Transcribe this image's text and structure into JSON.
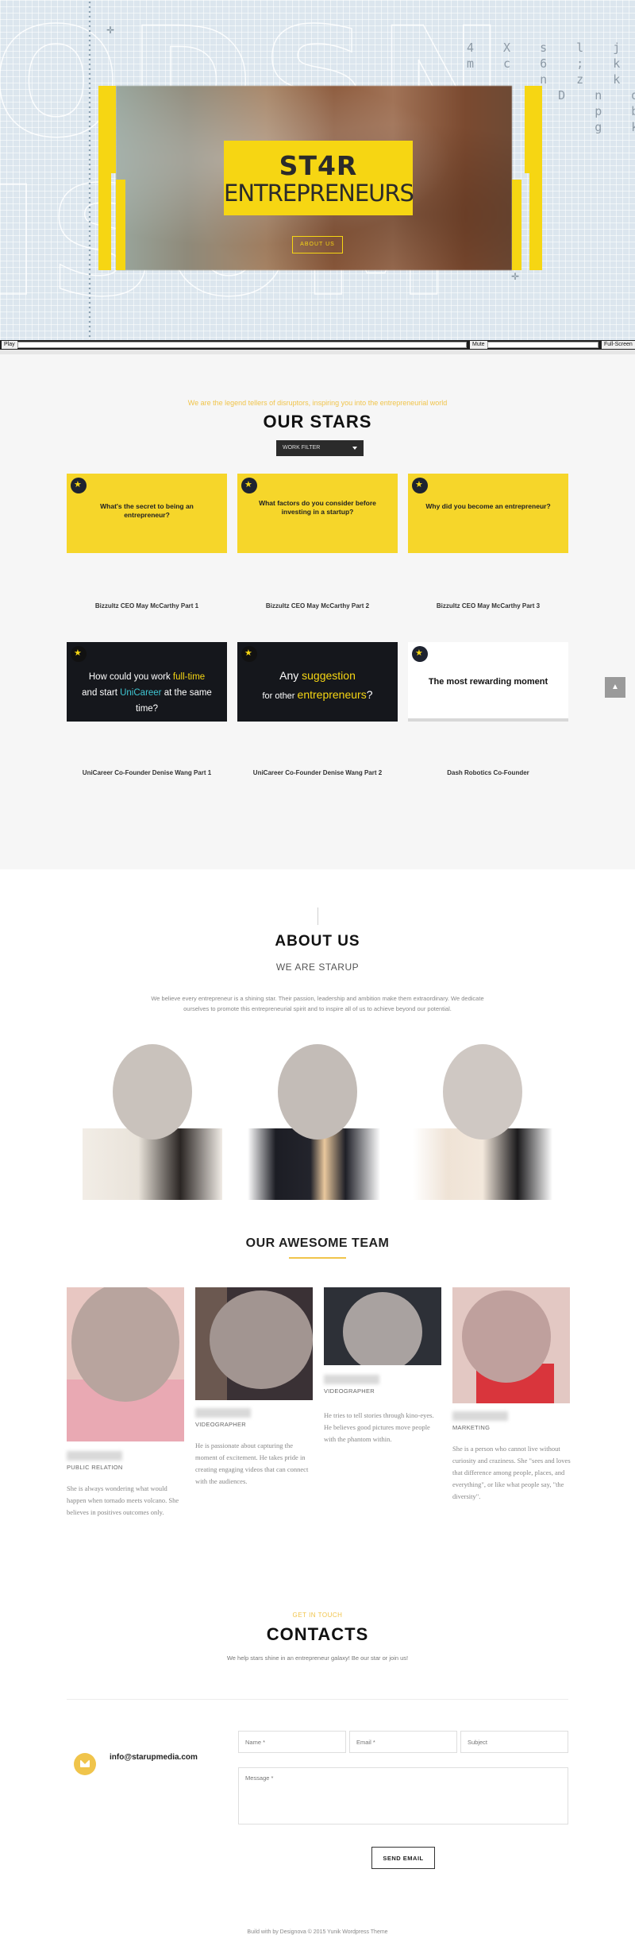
{
  "hero": {
    "logo_line1": "ST4R",
    "logo_line2": "ENTREPRENEURS",
    "about_button": "ABOUT US",
    "player": {
      "play_label": "Play",
      "mute_label": "Mute",
      "fullscreen_label": "Full-Screen"
    }
  },
  "stars": {
    "tagline": "We are the legend tellers of disruptors, inspiring you into the entrepreneurial world",
    "title": "OUR STARS",
    "filter_label": "WORK FILTER",
    "cards": [
      {
        "style": "yellow",
        "question": "What's the secret to being an entrepreneur?",
        "caption": "Bizzultz CEO May McCarthy Part 1"
      },
      {
        "style": "yellow",
        "question": "What factors do you consider before investing in a startup?",
        "caption": "Bizzultz CEO May McCarthy Part 2"
      },
      {
        "style": "yellow",
        "question": "Why did you become an entrepreneur?",
        "caption": "Bizzultz CEO May McCarthy Part 3"
      },
      {
        "style": "dark",
        "question_parts": [
          "How could you work ",
          "full-time",
          " and start ",
          "UniCareer",
          " at the same time?"
        ],
        "caption": "UniCareer Co-Founder Denise Wang Part 1"
      },
      {
        "style": "dark",
        "question_parts": [
          "Any ",
          "suggestion",
          " for other ",
          "entrepreneurs",
          "?"
        ],
        "caption": "UniCareer Co-Founder Denise Wang Part 2"
      },
      {
        "style": "white",
        "question": "The most rewarding moment",
        "caption": "Dash Robotics Co-Founder"
      }
    ]
  },
  "about": {
    "title": "ABOUT US",
    "subtitle": "WE ARE STARUP",
    "description": "We believe every entrepreneur is a shining star. Their passion, leadership and ambition make them extraordinary. We dedicate ourselves to promote this entrepreneurial spirit and to inspire all of us to achieve beyond our potential.",
    "team_title": "OUR AWESOME TEAM",
    "members": [
      {
        "role": "PUBLIC RELATION",
        "bio": "She is always wondering what would happen when tornado meets volcano. She believes in positives outcomes only."
      },
      {
        "role": "VIDEOGRAPHER",
        "bio": "He is passionate about capturing the moment of excitement. He takes pride in creating engaging videos that can connect with the audiences."
      },
      {
        "role": "VIDEOGRAPHER",
        "bio": "He tries to tell stories through kino-eyes. He believes good pictures move people with the phantom within."
      },
      {
        "role": "MARKETING",
        "bio": "She is a person who cannot live without curiosity and craziness. She \"sees and loves that difference among people, places, and everything\", or like what people say, \"the diversity\"."
      }
    ]
  },
  "contacts": {
    "tag": "GET IN TOUCH",
    "title": "CONTACTS",
    "subtitle": "We help stars shine in an entrepreneur galaxy! Be our star or join us!",
    "email": "info@starupmedia.com",
    "name_placeholder": "Name *",
    "email_placeholder": "Email *",
    "subject_placeholder": "Subject",
    "message_placeholder": "Message *",
    "send_label": "SEND EMAIL",
    "footer": "Build with  by Designova  © 2015 Yunik Wordpress Theme"
  },
  "colors": {
    "accent_yellow": "#f6d613",
    "accent_gold": "#f0c44b",
    "dark": "#15171c"
  }
}
